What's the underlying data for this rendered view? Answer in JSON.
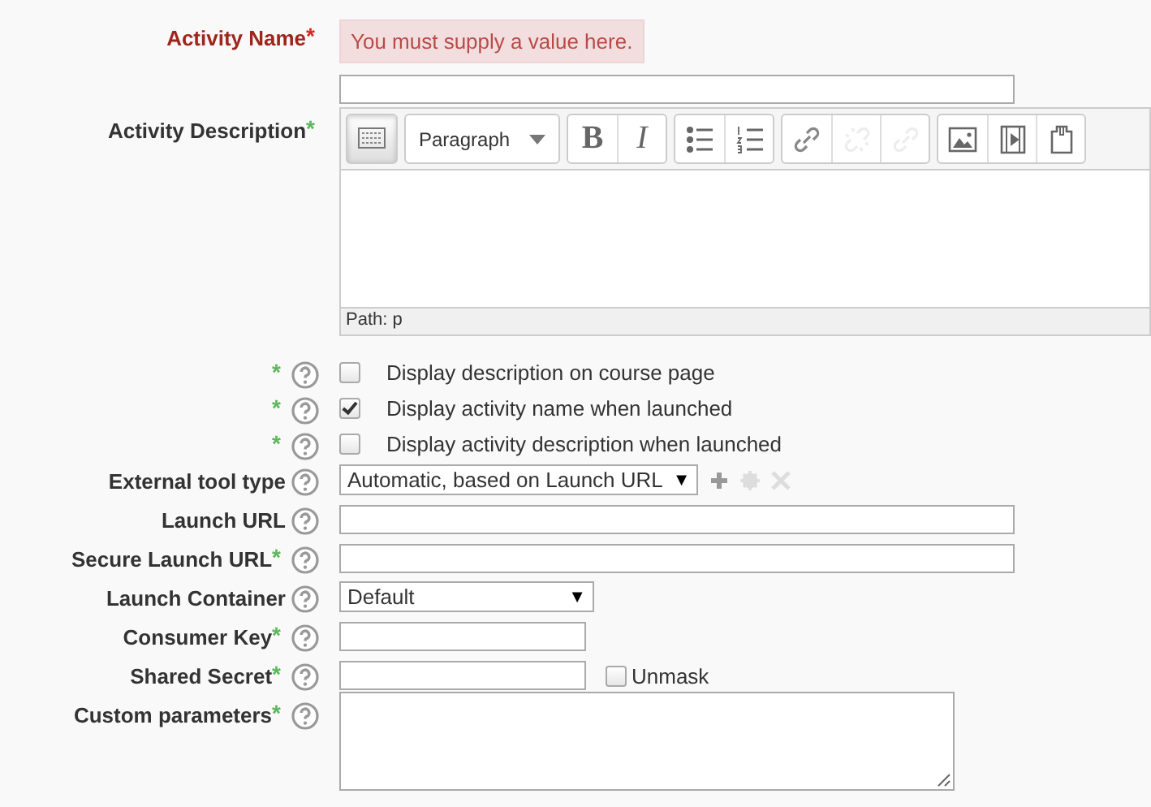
{
  "form": {
    "fields": [
      {
        "kind": "text",
        "label": "Activity Name",
        "star": "*",
        "required": true,
        "help": false,
        "error": "You must supply a value here."
      },
      {
        "kind": "editor",
        "label": "Activity Description",
        "star": "*",
        "required": false,
        "help": false,
        "editor": {
          "toolbar": [
            [
              {
                "kind": "keyboard",
                "pressed": true,
                "disabled": false
              }
            ],
            [
              {
                "kind": "dropdown",
                "text": "Paragraph"
              }
            ],
            [
              {
                "kind": "bold",
                "text": "B",
                "pressed": false,
                "disabled": false
              },
              {
                "kind": "italic",
                "text": "I",
                "pressed": false,
                "disabled": false
              }
            ],
            [
              {
                "kind": "bullets",
                "pressed": false,
                "disabled": false
              },
              {
                "kind": "numbers",
                "pressed": false,
                "disabled": false
              }
            ],
            [
              {
                "kind": "link",
                "pressed": false,
                "disabled": false
              },
              {
                "kind": "unlink",
                "pressed": false,
                "disabled": true
              },
              {
                "kind": "anchor",
                "pressed": false,
                "disabled": true
              }
            ],
            [
              {
                "kind": "image",
                "pressed": false,
                "disabled": false
              },
              {
                "kind": "media",
                "pressed": false,
                "disabled": false
              },
              {
                "kind": "files",
                "pressed": false,
                "disabled": false
              }
            ]
          ],
          "path": "Path: p"
        }
      },
      {
        "kind": "checkbox",
        "star": "*",
        "required": false,
        "help": true,
        "checked": false,
        "text": "Display description on course page"
      },
      {
        "kind": "checkbox",
        "star": "*",
        "required": false,
        "help": true,
        "checked": true,
        "text": "Display activity name when launched"
      },
      {
        "kind": "checkbox",
        "star": "*",
        "required": false,
        "help": true,
        "checked": false,
        "text": "Display activity description when launched"
      },
      {
        "kind": "tooltype",
        "label": "External tool type",
        "help": true,
        "value": "Automatic, based on Launch URL",
        "arrow": "▼",
        "actions": [
          {
            "kind": "add",
            "disabled": false
          },
          {
            "kind": "configure",
            "disabled": true
          },
          {
            "kind": "remove",
            "disabled": true
          }
        ]
      },
      {
        "kind": "text",
        "label": "Launch URL",
        "help": true
      },
      {
        "kind": "text",
        "label": "Secure Launch URL",
        "star": "*",
        "required": false,
        "help": true
      },
      {
        "kind": "select",
        "label": "Launch Container",
        "help": true,
        "value": "Default",
        "arrow": "▼"
      },
      {
        "kind": "key",
        "label": "Consumer Key",
        "star": "*",
        "required": false,
        "help": true
      },
      {
        "kind": "secret",
        "label": "Shared Secret",
        "star": "*",
        "required": false,
        "help": true,
        "unmask": {
          "checked": false,
          "text": "Unmask"
        }
      },
      {
        "kind": "textarea",
        "label": "Custom parameters",
        "star": "*",
        "required": false,
        "help": true
      }
    ]
  }
}
